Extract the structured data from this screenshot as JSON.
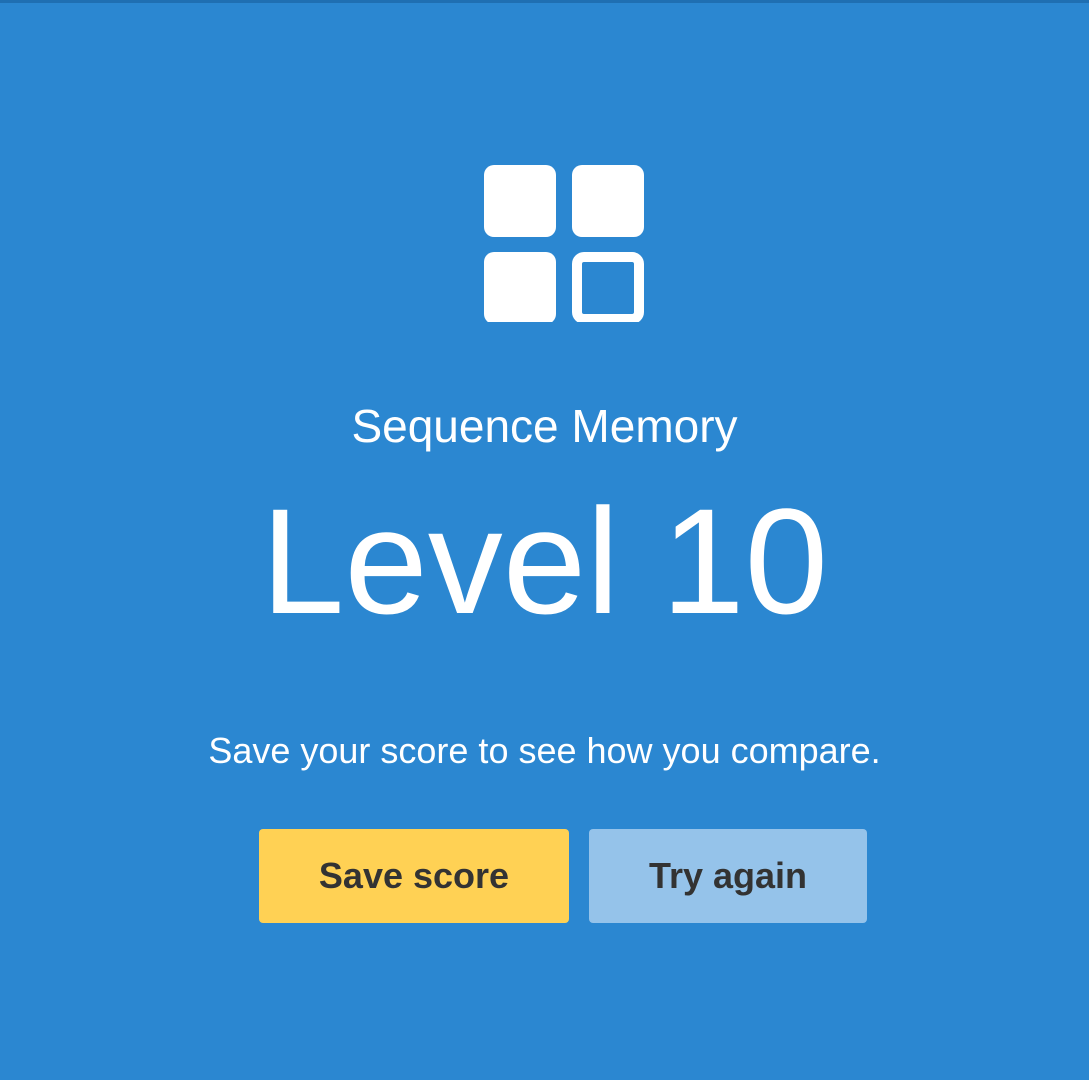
{
  "test": {
    "icon": "sequence-memory-grid-icon",
    "title": "Sequence Memory",
    "result": "Level 10",
    "message": "Save your score to see how you compare."
  },
  "actions": {
    "save_label": "Save score",
    "retry_label": "Try again"
  },
  "colors": {
    "background": "#2b87d1",
    "save_button": "#ffd154",
    "retry_button": "#95c3ea",
    "button_text": "#333333",
    "foreground": "#ffffff"
  }
}
